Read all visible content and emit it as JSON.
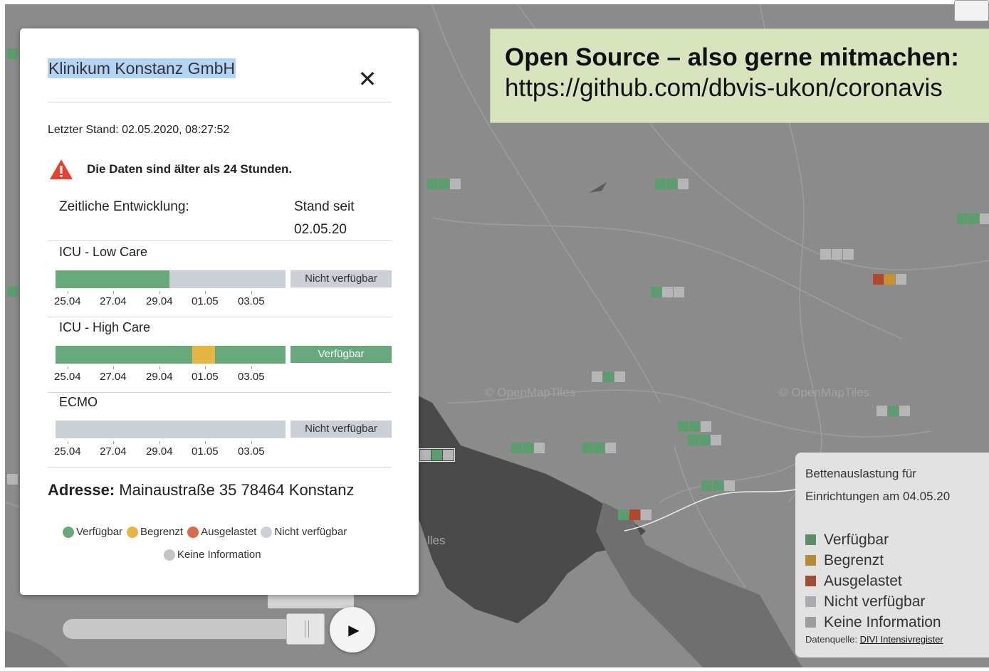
{
  "banner": {
    "line1": "Open Source – also gerne mitmachen:",
    "line2": "https://github.com/dbvis-ukon/coronavis"
  },
  "map": {
    "watermarks": [
      "© OpenMapTiles",
      "© OpenMapTiles",
      "lles"
    ]
  },
  "popup": {
    "title": "Klinikum Konstanz GmbH",
    "last_update": "Letzter Stand: 02.05.2020, 08:27:52",
    "warning": "Die Daten sind älter als 24 Stunden.",
    "header_left": "Zeitliche Entwicklung:",
    "header_right_1": "Stand seit",
    "header_right_2": "02.05.20",
    "ticks": [
      "25.04",
      "27.04",
      "29.04",
      "01.05",
      "03.05"
    ],
    "rows": [
      {
        "label": "ICU - Low Care",
        "status": "Nicht verfügbar",
        "segments": [
          {
            "state": "Verfügbar",
            "fraction": 0.495
          },
          {
            "state": "Nicht verfügbar",
            "fraction": 0.505
          }
        ]
      },
      {
        "label": "ICU - High Care",
        "status": "Verfügbar",
        "segments": [
          {
            "state": "Verfügbar",
            "fraction": 0.595
          },
          {
            "state": "Begrenzt",
            "fraction": 0.1
          },
          {
            "state": "Verfügbar",
            "fraction": 0.305
          }
        ]
      },
      {
        "label": "ECMO",
        "status": "Nicht verfügbar",
        "segments": [
          {
            "state": "Nicht verfügbar",
            "fraction": 1.0
          }
        ]
      }
    ],
    "address_label": "Adresse:",
    "address_value": "Mainaustraße 35 78464 Konstanz",
    "legend": [
      {
        "label": "Verfügbar",
        "color": "#67a97b"
      },
      {
        "label": "Begrenzt",
        "color": "#e7b541"
      },
      {
        "label": "Ausgelastet",
        "color": "#d96a4a"
      },
      {
        "label": "Nicht verfügbar",
        "color": "#cbcfd6"
      },
      {
        "label": "Keine Information",
        "color": "#c4c4c4"
      }
    ]
  },
  "map_legend": {
    "title_line1": "Bettenauslastung für",
    "title_line2": "Einrichtungen am 04.05.20",
    "items": [
      {
        "label": "Verfügbar",
        "color": "#5a8f6a"
      },
      {
        "label": "Begrenzt",
        "color": "#b58a35"
      },
      {
        "label": "Ausgelastet",
        "color": "#a24c36"
      },
      {
        "label": "Nicht verfügbar",
        "color": "#a9abb2"
      },
      {
        "label": "Keine Information",
        "color": "#9d9d9d"
      }
    ],
    "source_prefix": "Datenquelle:",
    "source_link": "DIVI Intensivregister"
  },
  "colors": {
    "Verfügbar": "#67a97b",
    "Begrenzt": "#e7b541",
    "Ausgelastet": "#d96a4a",
    "Nicht verfügbar": "#cbcfd6",
    "Keine Information": "#c4c4c4"
  }
}
